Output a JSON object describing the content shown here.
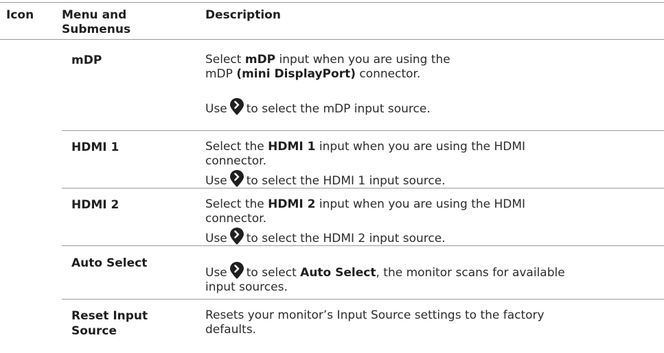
{
  "header": {
    "icon_col": "Icon",
    "menu_col_line1": "Menu and",
    "menu_col_line2": "Submenus",
    "desc_col": "Description"
  },
  "rows": [
    {
      "name": "mDP",
      "p1_pre": "Select ",
      "p1_bold": "mDP",
      "p1_mid": " input when you are using the",
      "p1_line2_pre": "mDP ",
      "p1_line2_bold": "(mini DisplayPort)",
      "p1_line2_post": " connector.",
      "p2_pre": "Use",
      "p2_post": "to select the mDP input source."
    },
    {
      "name": "HDMI 1",
      "p1_pre": "Select the ",
      "p1_bold": "HDMI 1",
      "p1_post": " input when you are using the HDMI",
      "p1_line2": "connector.",
      "p2_pre": "Use",
      "p2_post": "to select the HDMI 1 input source."
    },
    {
      "name": "HDMI 2",
      "p1_pre": "Select the ",
      "p1_bold": "HDMI 2",
      "p1_post": " input when you are using the HDMI",
      "p1_line2": "connector.",
      "p2_pre": "Use",
      "p2_post": "to select the HDMI 2 input source."
    },
    {
      "name": "Auto Select",
      "p1_pre": "Use",
      "p1_mid": "to select ",
      "p1_bold": "Auto Select",
      "p1_post": ", the monitor scans for available",
      "p1_line2": "input sources."
    },
    {
      "name_line1": "Reset Input",
      "name_line2": "Source",
      "p1": "Resets your monitor’s Input Source settings to the factory",
      "p1_line2": "defaults."
    }
  ],
  "icon": {
    "name": "nav-forward-icon",
    "fill": "#1f1f1f",
    "glyph": "#ffffff"
  }
}
